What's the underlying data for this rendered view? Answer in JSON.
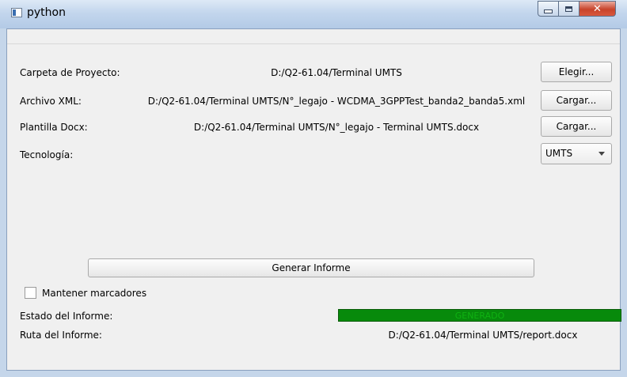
{
  "window": {
    "title": "python",
    "icon": "python-app-icon",
    "controls": [
      "minimize-icon",
      "maximize-icon",
      "close-icon"
    ]
  },
  "form": {
    "project_folder": {
      "label": "Carpeta de Proyecto:",
      "value": "D:/Q2-61.04/Terminal UMTS",
      "button": "Elegir..."
    },
    "xml_file": {
      "label": "Archivo XML:",
      "value": "D:/Q2-61.04/Terminal UMTS/N°_legajo - WCDMA_3GPPTest_banda2_banda5.xml",
      "button": "Cargar..."
    },
    "docx_template": {
      "label": "Plantilla Docx:",
      "value": "D:/Q2-61.04/Terminal UMTS/N°_legajo - Terminal UMTS.docx",
      "button": "Cargar..."
    },
    "technology": {
      "label": "Tecnología:",
      "selected": "UMTS"
    },
    "generate_button": "Generar Informe",
    "keep_markers": {
      "label": "Mantener marcadores",
      "checked": false
    },
    "report_status": {
      "label": "Estado del Informe:",
      "text": "GENERADO",
      "progress": 1.0,
      "color": "#078a0b"
    },
    "report_path": {
      "label": "Ruta del Informe:",
      "value": "D:/Q2-61.04/Terminal UMTS/report.docx"
    }
  }
}
